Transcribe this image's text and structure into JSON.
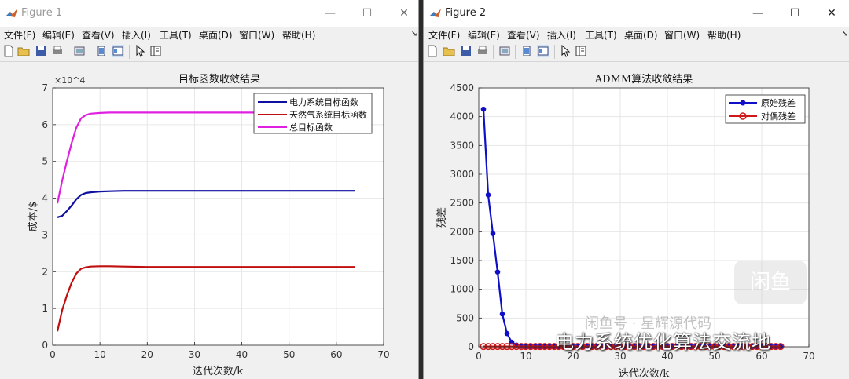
{
  "windows": [
    {
      "title": "Figure 1",
      "menu": [
        "文件(F)",
        "编辑(E)",
        "查看(V)",
        "插入(I)",
        "工具(T)",
        "桌面(D)",
        "窗口(W)",
        "帮助(H)"
      ]
    },
    {
      "title": "Figure 2",
      "menu": [
        "文件(F)",
        "编辑(E)",
        "查看(V)",
        "插入(I)",
        "工具(T)",
        "桌面(D)",
        "窗口(W)",
        "帮助(H)"
      ]
    }
  ],
  "titlebar_buttons": {
    "minimize": "—",
    "maximize": "☐",
    "close": "✕"
  },
  "menu_overflow": "➘",
  "toolbar_icons": [
    "new-figure-icon",
    "open-file-icon",
    "save-icon",
    "print-icon",
    "link-plot-icon",
    "hide-plot-tools-icon",
    "show-plot-tools-icon",
    "edit-plot-arrow-icon",
    "plot-browser-icon"
  ],
  "chart_data": [
    {
      "type": "line",
      "title": "目标函数收敛结果",
      "xlabel": "迭代次数/k",
      "ylabel": "成本/$",
      "exponent_label": "×10^4",
      "xlim": [
        0,
        70
      ],
      "ylim": [
        0,
        7
      ],
      "xticks": [
        "0",
        "10",
        "20",
        "30",
        "40",
        "50",
        "60",
        "70"
      ],
      "yticks": [
        "0",
        "1",
        "2",
        "3",
        "4",
        "5",
        "6",
        "7"
      ],
      "grid": true,
      "legend_position": "top-right",
      "series": [
        {
          "name": "电力系统目标函数",
          "color": "#0f0fa0",
          "x": [
            1,
            2,
            3,
            4,
            5,
            6,
            7,
            8,
            10,
            12,
            15,
            20,
            30,
            40,
            50,
            64
          ],
          "y": [
            3.48,
            3.52,
            3.65,
            3.8,
            3.97,
            4.09,
            4.14,
            4.16,
            4.18,
            4.19,
            4.2,
            4.2,
            4.2,
            4.2,
            4.2,
            4.2
          ]
        },
        {
          "name": "天然气系统目标函数",
          "color": "#c01010",
          "x": [
            1,
            2,
            3,
            4,
            5,
            6,
            7,
            8,
            10,
            12,
            15,
            20,
            30,
            40,
            50,
            64
          ],
          "y": [
            0.38,
            0.95,
            1.35,
            1.7,
            1.95,
            2.08,
            2.12,
            2.14,
            2.15,
            2.15,
            2.14,
            2.13,
            2.13,
            2.13,
            2.13,
            2.13
          ]
        },
        {
          "name": "总目标函数",
          "color": "#e020e0",
          "x": [
            1,
            2,
            3,
            4,
            5,
            6,
            7,
            8,
            10,
            12,
            15,
            20,
            30,
            40,
            50,
            64
          ],
          "y": [
            3.86,
            4.47,
            5.0,
            5.5,
            5.92,
            6.17,
            6.26,
            6.3,
            6.32,
            6.33,
            6.33,
            6.33,
            6.33,
            6.33,
            6.33,
            6.33
          ]
        }
      ]
    },
    {
      "type": "line",
      "title": "ADMM算法收敛结果",
      "xlabel": "迭代次数/k",
      "ylabel": "残差",
      "xlim": [
        0,
        70
      ],
      "ylim": [
        0,
        4500
      ],
      "xticks": [
        "0",
        "10",
        "20",
        "30",
        "40",
        "50",
        "60",
        "70"
      ],
      "yticks": [
        "0",
        "500",
        "1000",
        "1500",
        "2000",
        "2500",
        "3000",
        "3500",
        "4000",
        "4500"
      ],
      "grid": true,
      "legend_position": "top-right",
      "markers": "circle",
      "series": [
        {
          "name": "原始残差",
          "color": "#0f0fc8",
          "x": [
            1,
            2,
            3,
            4,
            5,
            6,
            7,
            8,
            9,
            10,
            11,
            12,
            13,
            14,
            15,
            16,
            17,
            18,
            19,
            20,
            21,
            22,
            23,
            24,
            25,
            26,
            27,
            28,
            29,
            30,
            31,
            32,
            33,
            34,
            35,
            36,
            37,
            38,
            39,
            40,
            41,
            42,
            43,
            44,
            45,
            46,
            47,
            48,
            49,
            50,
            51,
            52,
            53,
            54,
            55,
            56,
            57,
            58,
            59,
            60,
            61,
            62,
            63,
            64
          ],
          "y": [
            4130,
            2640,
            1970,
            1300,
            570,
            230,
            80,
            30,
            12,
            5,
            3,
            2,
            1,
            1,
            1,
            1,
            0,
            0,
            0,
            0,
            0,
            0,
            0,
            0,
            0,
            0,
            0,
            0,
            0,
            0,
            0,
            0,
            0,
            0,
            0,
            0,
            0,
            0,
            0,
            0,
            0,
            0,
            0,
            0,
            0,
            0,
            0,
            0,
            0,
            0,
            0,
            0,
            0,
            0,
            0,
            0,
            0,
            0,
            0,
            0,
            0,
            0,
            0,
            0
          ]
        },
        {
          "name": "对偶残差",
          "color": "#d01818",
          "x": [
            1,
            2,
            3,
            4,
            5,
            6,
            7,
            8,
            9,
            10,
            11,
            12,
            13,
            14,
            15,
            16,
            17,
            18,
            19,
            20,
            21,
            22,
            23,
            24,
            25,
            26,
            27,
            28,
            29,
            30,
            31,
            32,
            33,
            34,
            35,
            36,
            37,
            38,
            39,
            40,
            41,
            42,
            43,
            44,
            45,
            46,
            47,
            48,
            49,
            50,
            51,
            52,
            53,
            54,
            55,
            56,
            57,
            58,
            59,
            60,
            61,
            62,
            63,
            64
          ],
          "y": [
            5,
            5,
            5,
            5,
            5,
            5,
            5,
            5,
            5,
            5,
            5,
            5,
            5,
            5,
            5,
            5,
            5,
            5,
            5,
            5,
            5,
            5,
            5,
            5,
            5,
            5,
            5,
            5,
            5,
            5,
            5,
            5,
            5,
            5,
            5,
            5,
            5,
            5,
            5,
            5,
            5,
            5,
            5,
            5,
            5,
            5,
            5,
            5,
            5,
            5,
            5,
            5,
            5,
            5,
            5,
            5,
            5,
            5,
            5,
            5,
            5,
            5,
            5,
            5
          ]
        }
      ]
    }
  ],
  "watermark": {
    "text": "电力系统优化算法交流地",
    "ghost_text": "闲鱼号 · 星辉源代码",
    "logo_text": "闲鱼"
  }
}
